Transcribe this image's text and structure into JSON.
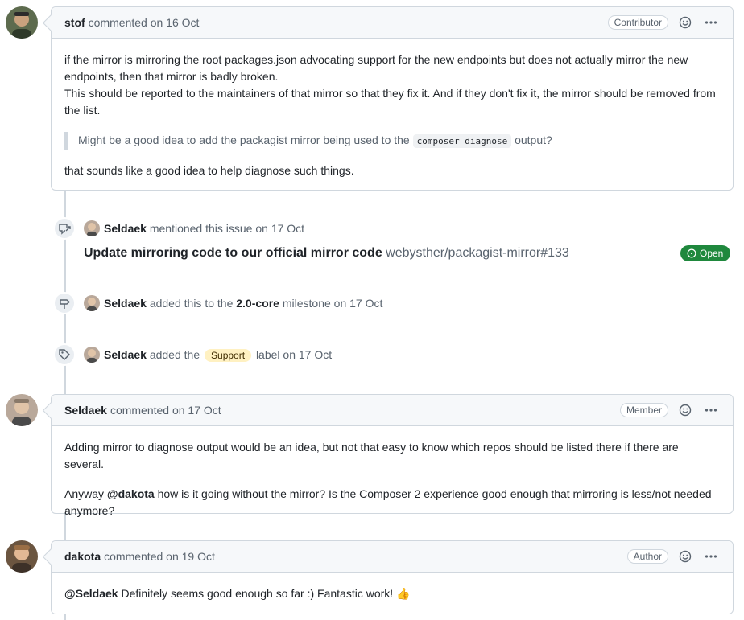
{
  "comments": [
    {
      "author": "stof",
      "meta": "commented on 16 Oct",
      "role": "Contributor",
      "p1": "if the mirror is mirroring the root packages.json advocating support for the new endpoints but does not actually mirror the new endpoints, then that mirror is badly broken.",
      "p1b": "This should be reported to the maintainers of that mirror so that they fix it. And if they don't fix it, the mirror should be removed from the list.",
      "quote_before": "Might be a good idea to add the packagist mirror being used to the",
      "quote_code": "composer diagnose",
      "quote_after": "output?",
      "p2": "that sounds like a good idea to help diagnose such things."
    },
    {
      "author": "Seldaek",
      "meta": "commented on 17 Oct",
      "role": "Member",
      "p1": "Adding mirror to diagnose output would be an idea, but not that easy to know which repos should be listed there if there are several.",
      "p2_before": "Anyway",
      "p2_mention": "@dakota",
      "p2_after": "how is it going without the mirror? Is the Composer 2 experience good enough that mirroring is less/not needed anymore?"
    },
    {
      "author": "dakota",
      "meta": "commented on 19 Oct",
      "role": "Author",
      "mention": "@Seldaek",
      "text": "Definitely seems good enough so far :) Fantastic work!",
      "emoji": "👍"
    }
  ],
  "events": {
    "mention": {
      "actor": "Seldaek",
      "text": "mentioned this issue",
      "date": "on 17 Oct",
      "ref_title": "Update mirroring code to our official mirror code",
      "ref_repo": "webysther/packagist-mirror#133",
      "status": "Open"
    },
    "milestone": {
      "actor": "Seldaek",
      "text_before": "added this to the",
      "milestone": "2.0-core",
      "text_after": "milestone",
      "date": "on 17 Oct"
    },
    "label": {
      "actor": "Seldaek",
      "text_before": "added the",
      "label": "Support",
      "text_after": "label",
      "date": "on 17 Oct",
      "label_color": "#fff1c2"
    }
  },
  "icons": {
    "smiley": "smiley-icon",
    "kebab": "kebab-horizontal-icon",
    "crossref": "cross-reference-icon",
    "milestone": "milestone-icon",
    "tag": "tag-icon",
    "open": "issue-opened-icon"
  },
  "colors": {
    "open_green": "#1f883d",
    "border": "#d0d7de",
    "header_bg": "#f6f8fa"
  }
}
